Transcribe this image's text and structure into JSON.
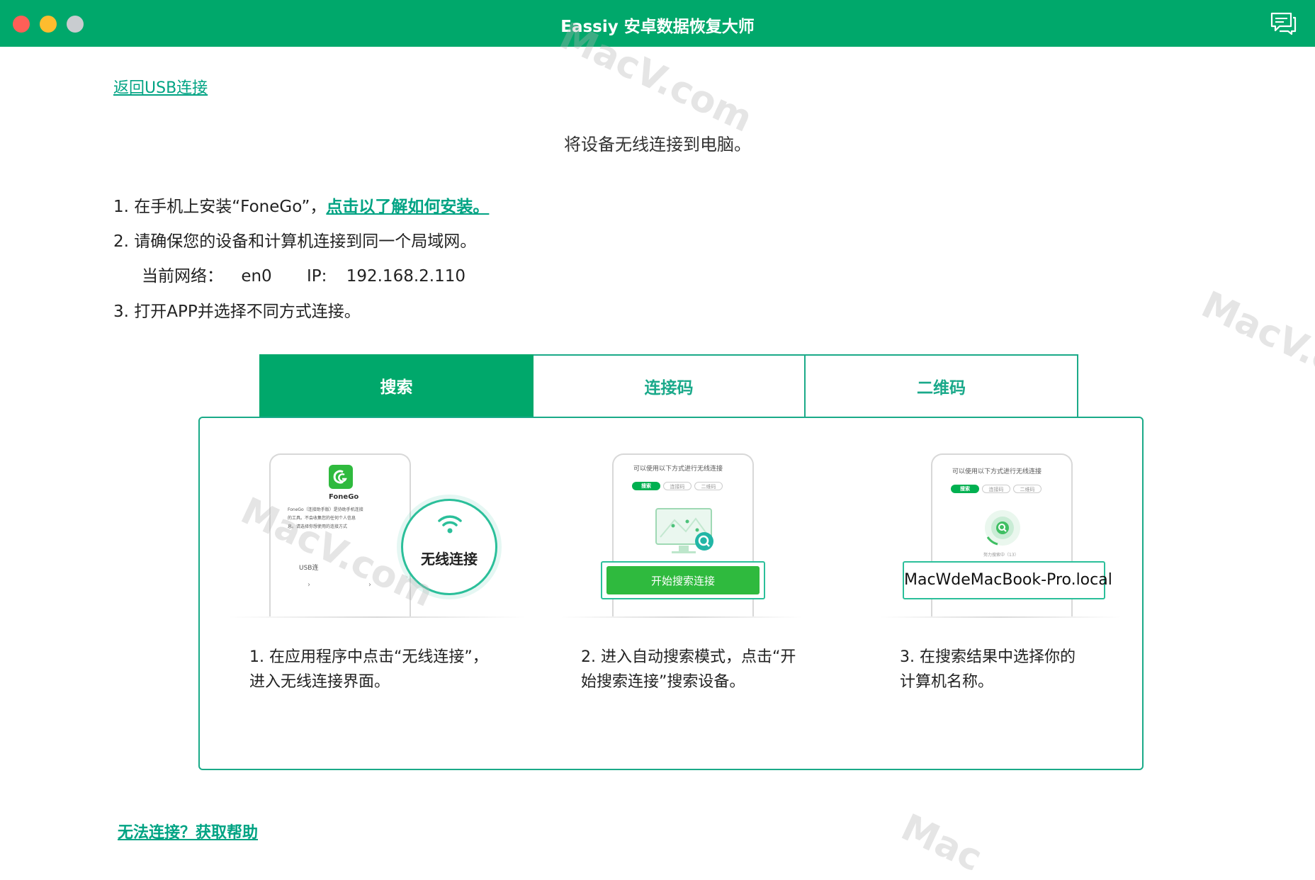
{
  "window": {
    "title": "Eassiy 安卓数据恢复大师"
  },
  "header": {
    "back_link": "返回USB连接",
    "heading": "将设备无线连接到电脑。"
  },
  "steps": {
    "step1_prefix": "1. 在手机上安装“FoneGo”，",
    "step1_link": "点击以了解如何安装。",
    "step2": "2. 请确保您的设备和计算机连接到同一个局域网。",
    "network_label": "当前网络：",
    "network_value": "en0",
    "ip_label": "IP:",
    "ip_value": "192.168.2.110",
    "step3": "3. 打开APP并选择不同方式连接。"
  },
  "tabs": [
    {
      "label": "搜索",
      "active": true
    },
    {
      "label": "连接码",
      "active": false
    },
    {
      "label": "二维码",
      "active": false
    }
  ],
  "illustrations": {
    "one": {
      "app_name": "FoneGo",
      "desc_line1": "FoneGo（连接助手版）是协助手机连接",
      "desc_line2": "的工具。不会收集您的任何个人信息",
      "desc_line3": "息。请选择你想使用的连接方式",
      "usb_label": "USB连",
      "wireless_badge": "无线连接"
    },
    "two": {
      "phone_title": "可以使用以下方式进行无线连接",
      "mini_tabs": [
        "搜索",
        "连接码",
        "二维码"
      ],
      "button": "开始搜索连接"
    },
    "three": {
      "phone_title": "可以使用以下方式进行无线连接",
      "mini_tabs": [
        "搜索",
        "连接码",
        "二维码"
      ],
      "searching": "努力搜索中（13）",
      "computer_name": "MacWdeMacBook-Pro.local"
    }
  },
  "captions": [
    {
      "line1": "1. 在应用程序中点击“无线连接”，",
      "line2": "进入无线连接界面。"
    },
    {
      "line1": "2. 进入自动搜索模式，点击“开",
      "line2": "始搜索连接”搜索设备。"
    },
    {
      "line1": "3. 在搜索结果中选择你的",
      "line2": "计算机名称。"
    }
  ],
  "footer": {
    "help_link": "无法连接？获取帮助"
  },
  "watermark": {
    "text1": "MacV.com",
    "text2": "MacV.c",
    "text3": "MacV.com",
    "text4": "Mac"
  },
  "colors": {
    "brand": "#00a86b",
    "link": "#00a383",
    "accent": "#2bbf9a"
  },
  "icons": {
    "feedback": "chat-bubble-icon",
    "wifi": "wifi-icon",
    "app_logo": "fonego-logo-icon"
  }
}
